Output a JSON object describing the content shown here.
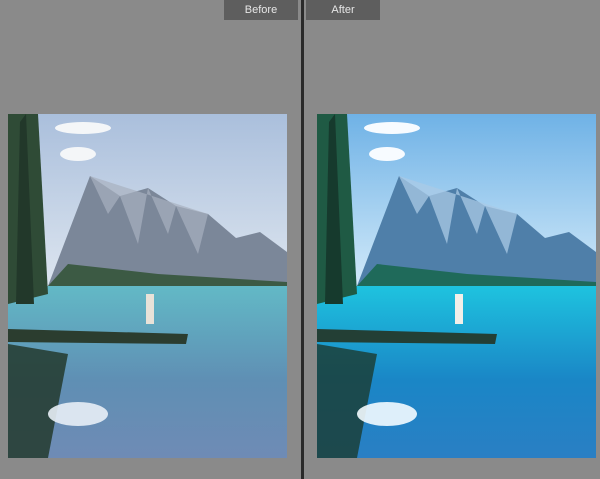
{
  "compare": {
    "before_label": "Before",
    "after_label": "After"
  },
  "colors": {
    "workspace_bg": "#8a8a8a",
    "divider": "#2a2a2a",
    "tab_bg": "#5e5e5e",
    "tab_text": "#e6e6e6"
  }
}
